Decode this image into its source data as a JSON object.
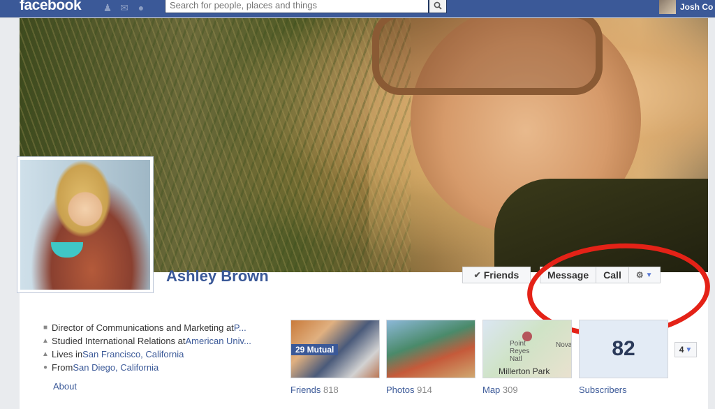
{
  "topbar": {
    "logo": "facebook",
    "search_placeholder": "Search for people, places and things",
    "user_name": "Josh Co"
  },
  "profile": {
    "name": "Ashley Brown"
  },
  "actions": {
    "friends_label": "Friends",
    "message_label": "Message",
    "call_label": "Call"
  },
  "about": {
    "rows": [
      {
        "text": "Director of Communications and Marketing at ",
        "link": "P..."
      },
      {
        "text": "Studied International Relations at ",
        "link": "American Univ..."
      },
      {
        "text": "Lives in ",
        "link": "San Francisco, California"
      },
      {
        "text": "From ",
        "link": "San Diego, California"
      }
    ],
    "about_link": "About"
  },
  "tiles": {
    "friends": {
      "label": "Friends",
      "count": "818",
      "badge": "29 Mutual"
    },
    "photos": {
      "label": "Photos",
      "count": "914"
    },
    "map": {
      "label": "Map",
      "count": "309",
      "place1": "Point Reyes Natl",
      "place2": "Millerton Park",
      "place3": "Nova"
    },
    "subscribers": {
      "label": "Subscribers",
      "count": "82"
    },
    "more": "4"
  },
  "colors": {
    "brand_blue": "#3b5998",
    "highlight_red": "#e42217"
  }
}
